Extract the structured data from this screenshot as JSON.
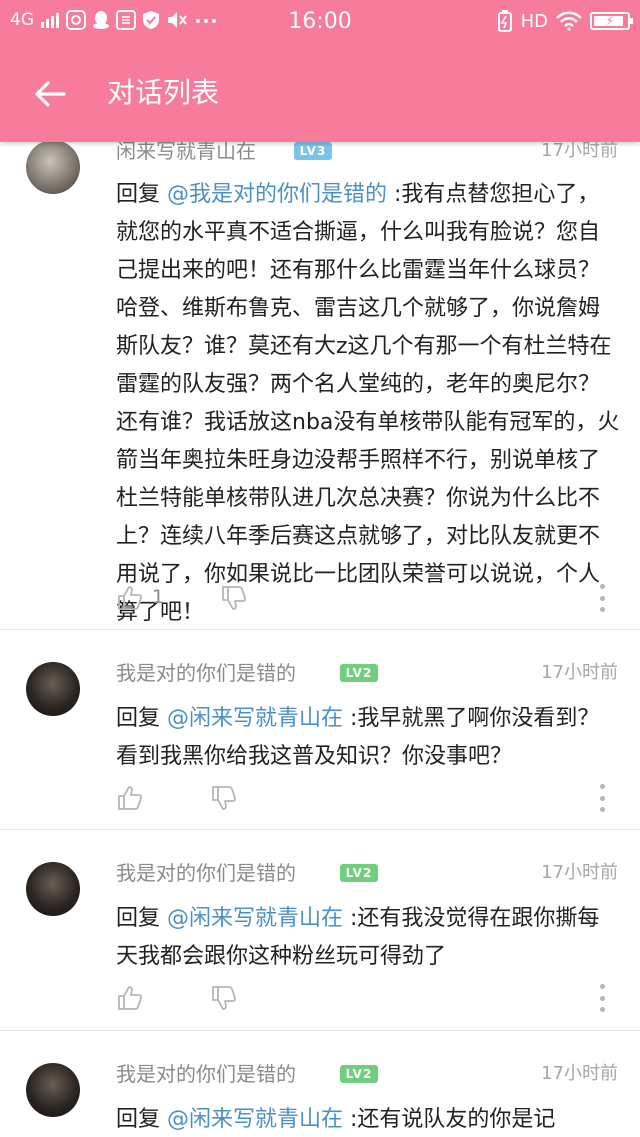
{
  "status_bar": {
    "network": "4G",
    "time": "16:00",
    "hd": "HD",
    "battery_level": 0.9
  },
  "toolbar": {
    "title": "对话列表"
  },
  "comments": [
    {
      "username": "闲来写就青山在",
      "level": "LV3",
      "level_color": "#7cc3ea",
      "time": "17小时前",
      "reply_prefix": "回复 ",
      "mention": "@我是对的你们是错的",
      "text": " :我有点替您担心了，就您的水平真不适合撕逼，什么叫我有脸说？您自己提出来的吧！还有那什么比雷霆当年什么球员？哈登、维斯布鲁克、雷吉这几个就够了，你说詹姆斯队友？谁？莫还有大z这几个有那一个有杜兰特在雷霆的队友强？两个名人堂纯的，老年的奥尼尔？还有谁？我话放这nba没有单核带队能有冠军的，火箭当年奥拉朱旺身边没帮手照样不行，别说单核了杜兰特能单核带队进几次总决赛？你说为什么比不上？连续八年季后赛这点就够了，对比队友就更不用说了，你如果说比一比团队荣誉可以说说，个人算了吧！",
      "likes": "1"
    },
    {
      "username": "我是对的你们是错的",
      "level": "LV2",
      "level_color": "#6fcf7c",
      "time": "17小时前",
      "reply_prefix": "回复 ",
      "mention": "@闲来写就青山在",
      "text": " :我早就黑了啊你没看到？看到我黑你给我这普及知识？你没事吧？",
      "likes": ""
    },
    {
      "username": "我是对的你们是错的",
      "level": "LV2",
      "level_color": "#6fcf7c",
      "time": "17小时前",
      "reply_prefix": "回复 ",
      "mention": "@闲来写就青山在",
      "text": " :还有我没觉得在跟你撕每天我都会跟你这种粉丝玩可得劲了",
      "likes": ""
    },
    {
      "username": "我是对的你们是错的",
      "level": "LV2",
      "level_color": "#6fcf7c",
      "time": "17小时前",
      "reply_prefix": "回复 ",
      "mention": "@闲来写就青山在",
      "text": " :还有说队友的你是记",
      "likes": ""
    }
  ]
}
